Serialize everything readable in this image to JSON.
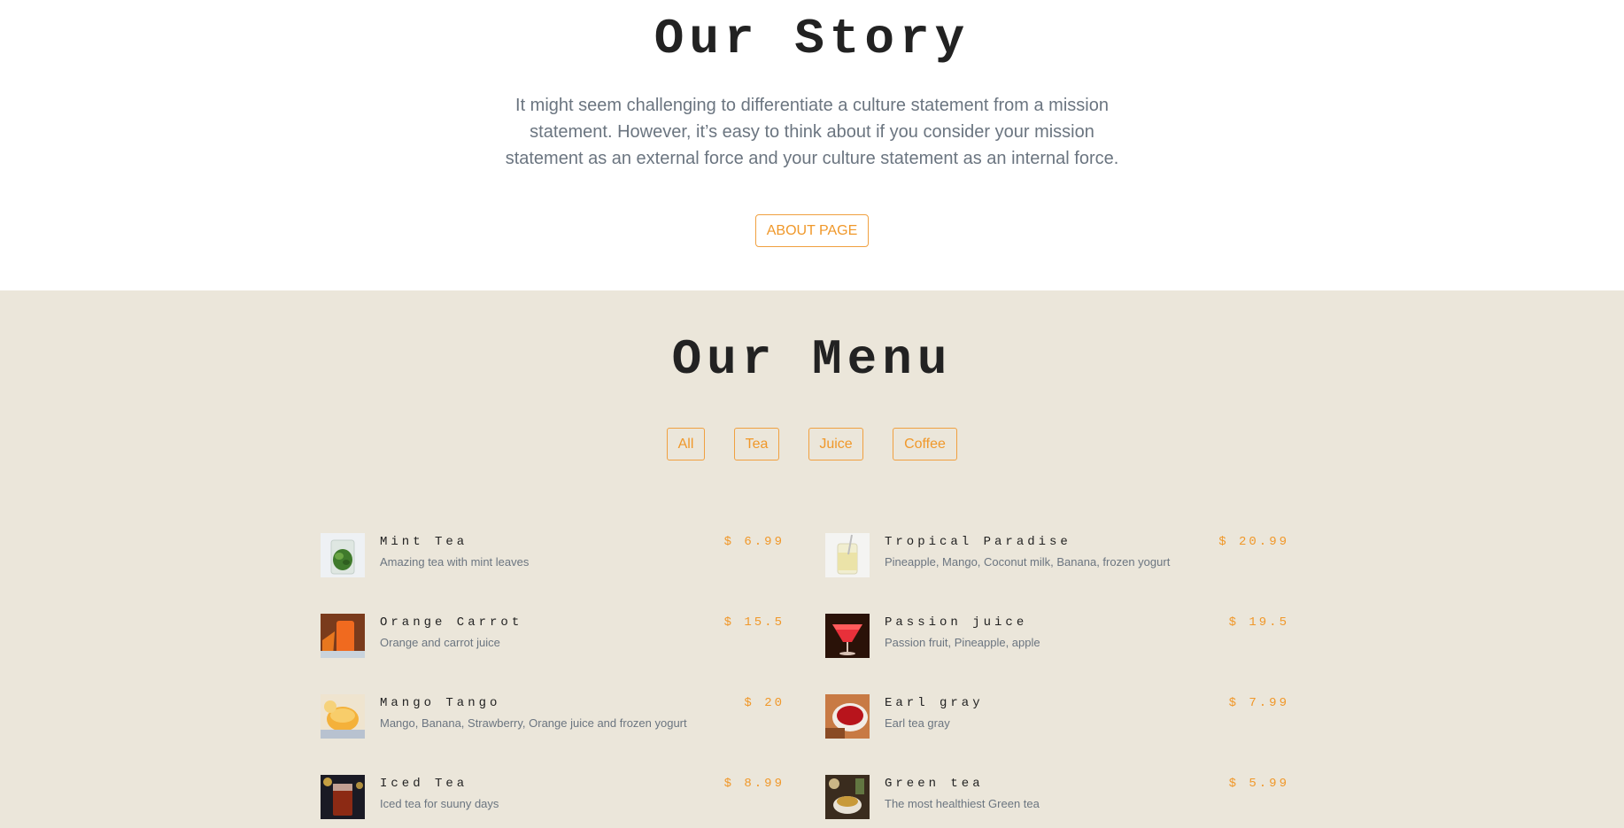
{
  "story": {
    "title": "Our Story",
    "text": "It might seem challenging to differentiate a culture statement from a mission statement. However, it’s easy to think about if you consider your mission statement as an external force and your culture statement as an internal force.",
    "button_label": "ABOUT PAGE"
  },
  "menu": {
    "title": "Our Menu",
    "filters": [
      "All",
      "Tea",
      "Juice",
      "Coffee"
    ],
    "items": [
      {
        "name": "Mint Tea",
        "desc": "Amazing tea with mint leaves",
        "price": "$ 6.99",
        "image": "mint-tea-image"
      },
      {
        "name": "Tropical Paradise",
        "desc": "Pineapple, Mango, Coconut milk, Banana, frozen yogurt",
        "price": "$ 20.99",
        "image": "tropical-paradise-image"
      },
      {
        "name": "Orange Carrot",
        "desc": "Orange and carrot juice",
        "price": "$ 15.5",
        "image": "orange-carrot-image"
      },
      {
        "name": "Passion juice",
        "desc": "Passion fruit, Pineapple, apple",
        "price": "$ 19.5",
        "image": "passion-juice-image"
      },
      {
        "name": "Mango Tango",
        "desc": "Mango, Banana, Strawberry, Orange juice and frozen yogurt",
        "price": "$ 20",
        "image": "mango-tango-image"
      },
      {
        "name": "Earl gray",
        "desc": "Earl tea gray",
        "price": "$ 7.99",
        "image": "earl-gray-image"
      },
      {
        "name": "Iced Tea",
        "desc": "Iced tea for suuny days",
        "price": "$ 8.99",
        "image": "iced-tea-image"
      },
      {
        "name": "Green tea",
        "desc": "The most healthiest Green tea",
        "price": "$ 5.99",
        "image": "green-tea-image"
      }
    ]
  },
  "colors": {
    "accent": "#f0982a",
    "menu_background": "#ebe6da",
    "heading": "#222222",
    "body_text": "#6b7580"
  }
}
